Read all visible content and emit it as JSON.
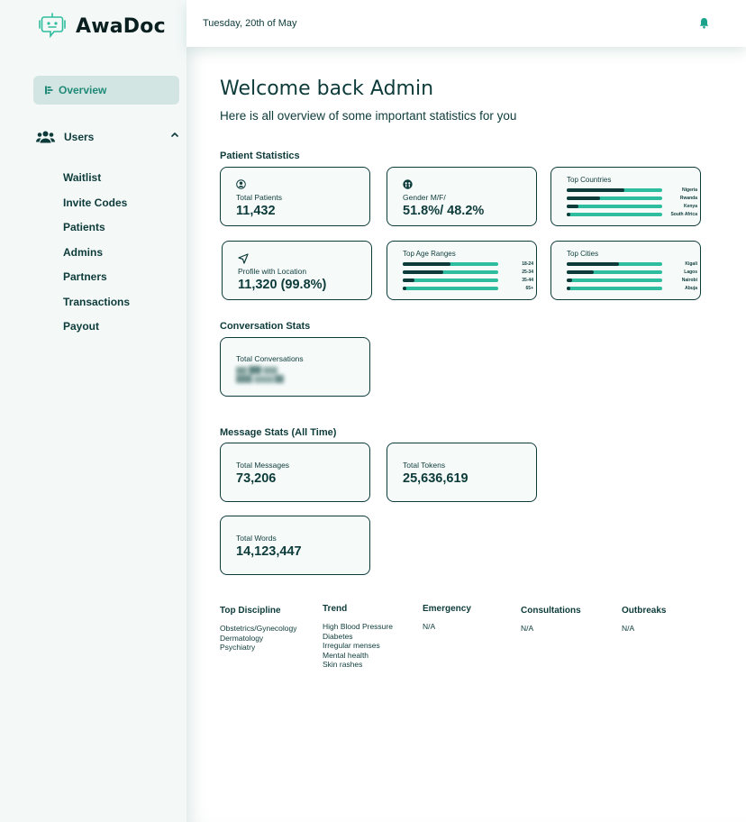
{
  "brand": {
    "name": "AwaDoc",
    "icon": "robot-chat-icon"
  },
  "sidebar": {
    "overview": {
      "label": "Overview",
      "icon": "overview-icon"
    },
    "users": {
      "label": "Users",
      "icon": "users-icon"
    },
    "sub_items": [
      "Waitlist",
      "Invite Codes",
      "Patients",
      "Admins",
      "Partners",
      "Transactions",
      "Payout"
    ]
  },
  "topbar": {
    "date": "Tuesday, 20th of May",
    "bell_icon": "bell-icon"
  },
  "main": {
    "welcome": "Welcome back Admin",
    "subtitle": "Here is all overview of some important statistics for you"
  },
  "patient_stats": {
    "title": "Patient Statistics",
    "total_patients": {
      "label": "Total Patients",
      "value": "11,432"
    },
    "gender": {
      "label": "Gender M/F/",
      "value": "51.8%/ 48.2%"
    },
    "profile_location": {
      "label": "Profile with Location",
      "value": "11,320 (99.8%)"
    },
    "top_countries": {
      "title": "Top Countries",
      "items": [
        {
          "label": "Nigeria",
          "share": 0.6
        },
        {
          "label": "Rwanda",
          "share": 0.35
        },
        {
          "label": "Kenya",
          "share": 0.12
        },
        {
          "label": "South Africa",
          "share": 0.04
        }
      ]
    },
    "top_age_ranges": {
      "title": "Top Age Ranges",
      "items": [
        {
          "label": "18-24",
          "share": 0.5
        },
        {
          "label": "25-34",
          "share": 0.42
        },
        {
          "label": "35-44",
          "share": 0.12
        },
        {
          "label": "65+",
          "share": 0.04
        }
      ]
    },
    "top_cities": {
      "title": "Top Cities",
      "items": [
        {
          "label": "Kigali",
          "share": 0.55
        },
        {
          "label": "Lagos",
          "share": 0.28
        },
        {
          "label": "Nairobi",
          "share": 0.06
        },
        {
          "label": "Abuja",
          "share": 0.04
        }
      ]
    }
  },
  "conversation_stats": {
    "title": "Conversation Stats",
    "total_conversations": {
      "label": "Total Conversations"
    }
  },
  "message_stats": {
    "title": "Message Stats (All Time)",
    "total_messages": {
      "label": "Total Messages",
      "value": "73,206"
    },
    "total_tokens": {
      "label": "Total Tokens",
      "value": "25,636,619"
    },
    "total_words": {
      "label": "Total Words",
      "value": "14,123,447"
    }
  },
  "info": {
    "top_discipline": {
      "label": "Top Discipline",
      "items": [
        "Obstetrics/Gynecology",
        "Dermatology",
        "Psychiatry"
      ]
    },
    "trend": {
      "label": "Trend",
      "items": [
        "High Blood Pressure",
        "Diabetes",
        "Irregular menses",
        "Mental health",
        "Skin rashes"
      ]
    },
    "emergency": {
      "label": "Emergency",
      "items": [
        "N/A"
      ]
    },
    "consultations": {
      "label": "Consultations",
      "items": [
        "N/A"
      ]
    },
    "outbreaks": {
      "label": "Outbreaks",
      "items": [
        "N/A"
      ]
    }
  },
  "colors": {
    "primary": "#0d3b3a",
    "accent": "#2ebd9e",
    "sidebar_bg": "#f4f9f8",
    "active_bg": "#d3e5e2"
  }
}
